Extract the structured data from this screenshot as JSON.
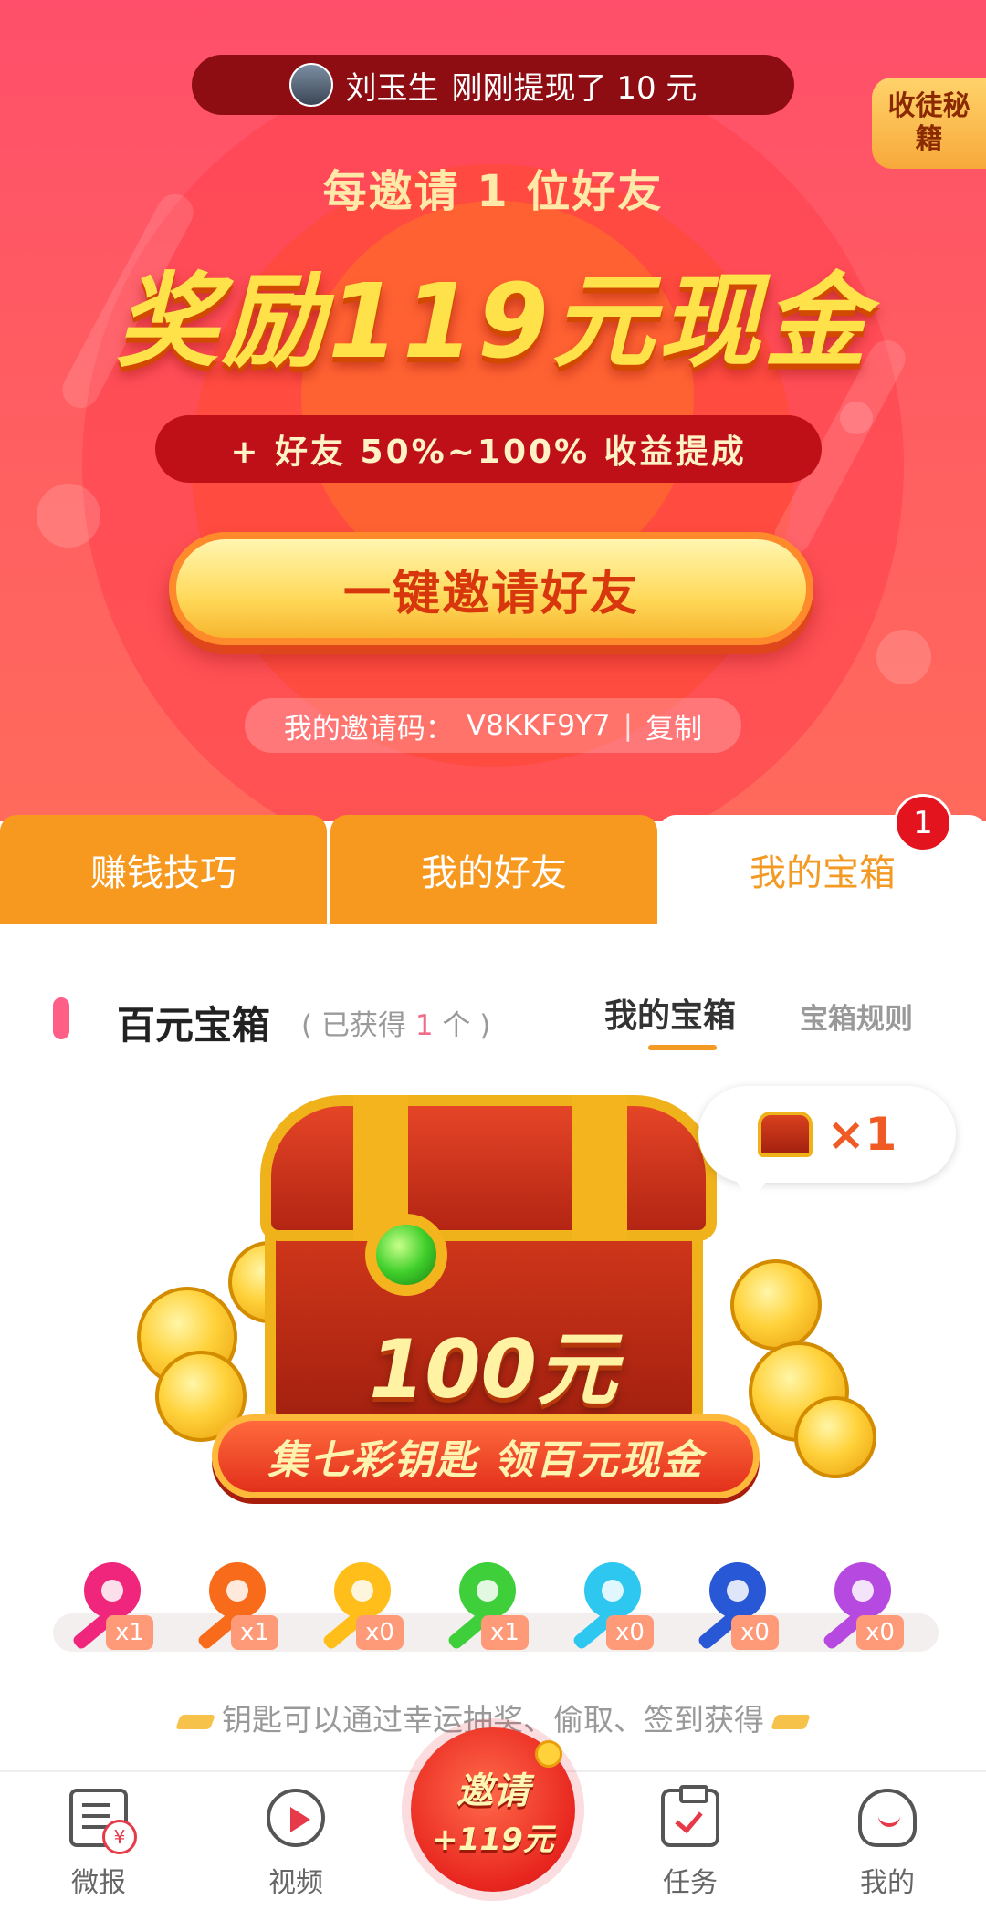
{
  "hero": {
    "ticker": {
      "name": "刘玉生",
      "message": "刚刚提现了 10 元"
    },
    "tips_badge": "收徒秘籍",
    "headline_small": "每邀请 1 位好友",
    "headline_large": "奖励119元现金",
    "subline": "+ 好友 50%~100% 收益提成",
    "invite_button": "一键邀请好友",
    "invite_code_label": "我的邀请码：",
    "invite_code": "V8KKF9Y7",
    "copy_label": "复制",
    "colors": {
      "background": "#ff5a63",
      "button_text": "#d8370d",
      "accent_yellow": "#ffe14a"
    }
  },
  "tabs": [
    {
      "label": "赚钱技巧",
      "active": false
    },
    {
      "label": "我的好友",
      "active": false
    },
    {
      "label": "我的宝箱",
      "active": true,
      "badge": "1"
    }
  ],
  "section": {
    "title": "百元宝箱",
    "count_prefix": "( 已获得",
    "count_value": "1",
    "count_suffix": "个 )",
    "subtabs": [
      {
        "label": "我的宝箱",
        "active": true
      },
      {
        "label": "宝箱规则",
        "active": false
      }
    ]
  },
  "chest": {
    "amount": "100元",
    "slogan": "集七彩钥匙 领百元现金",
    "count_label": "×1"
  },
  "keys": [
    {
      "color": "#f0267c",
      "count": "x1",
      "icon": "pink-key-icon"
    },
    {
      "color": "#f86b1a",
      "count": "x1",
      "icon": "orange-key-icon"
    },
    {
      "color": "#ffbe1a",
      "count": "x0",
      "icon": "yellow-key-icon"
    },
    {
      "color": "#3fcf3a",
      "count": "x1",
      "icon": "green-key-icon"
    },
    {
      "color": "#2ec7f0",
      "count": "x0",
      "icon": "cyan-key-icon"
    },
    {
      "color": "#2958d6",
      "count": "x0",
      "icon": "blue-key-icon"
    },
    {
      "color": "#b64ae0",
      "count": "x0",
      "icon": "purple-key-icon"
    }
  ],
  "hint": "钥匙可以通过幸运抽奖、偷取、签到获得",
  "bottom_nav": {
    "items": [
      {
        "label": "微报",
        "icon": "news-icon"
      },
      {
        "label": "视频",
        "icon": "video-play-icon"
      },
      {
        "label": "任务",
        "icon": "task-clipboard-icon"
      },
      {
        "label": "我的",
        "icon": "profile-icon"
      }
    ],
    "center": {
      "line1": "邀请",
      "line2": "+119元"
    }
  }
}
